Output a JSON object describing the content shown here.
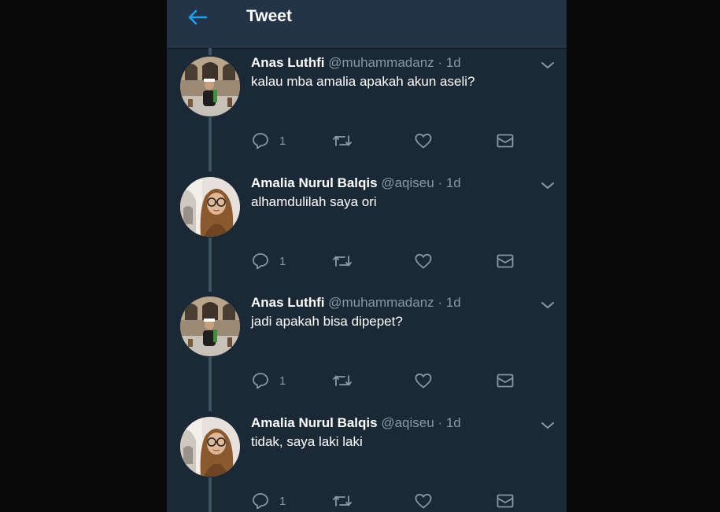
{
  "header": {
    "title": "Tweet"
  },
  "tweets": [
    {
      "name": "Anas Luthfi",
      "handle": "@muhammadanz",
      "time": "· 1d",
      "text": "kalau mba amalia apakah akun aseli?",
      "reply_count": "1",
      "avatar": "avatar-man"
    },
    {
      "name": "Amalia Nurul Balqis",
      "handle": "@aqiseu",
      "time": "· 1d",
      "text": "alhamdulilah saya ori",
      "reply_count": "1",
      "avatar": "avatar-woman"
    },
    {
      "name": "Anas Luthfi",
      "handle": "@muhammadanz",
      "time": "· 1d",
      "text": "jadi apakah bisa dipepet?",
      "reply_count": "1",
      "avatar": "avatar-man"
    },
    {
      "name": "Amalia Nurul Balqis",
      "handle": "@aqiseu",
      "time": "· 1d",
      "text": "tidak, saya laki laki",
      "reply_count": "1",
      "avatar": "avatar-woman"
    }
  ],
  "colors": {
    "background": "#1b2836",
    "header": "#243447",
    "accent": "#1da1f2",
    "muted": "#8899a6",
    "thread_line": "#3d5466"
  },
  "icons": [
    "back-arrow-icon",
    "chevron-down-icon",
    "reply-icon",
    "retweet-icon",
    "like-icon",
    "message-icon"
  ]
}
